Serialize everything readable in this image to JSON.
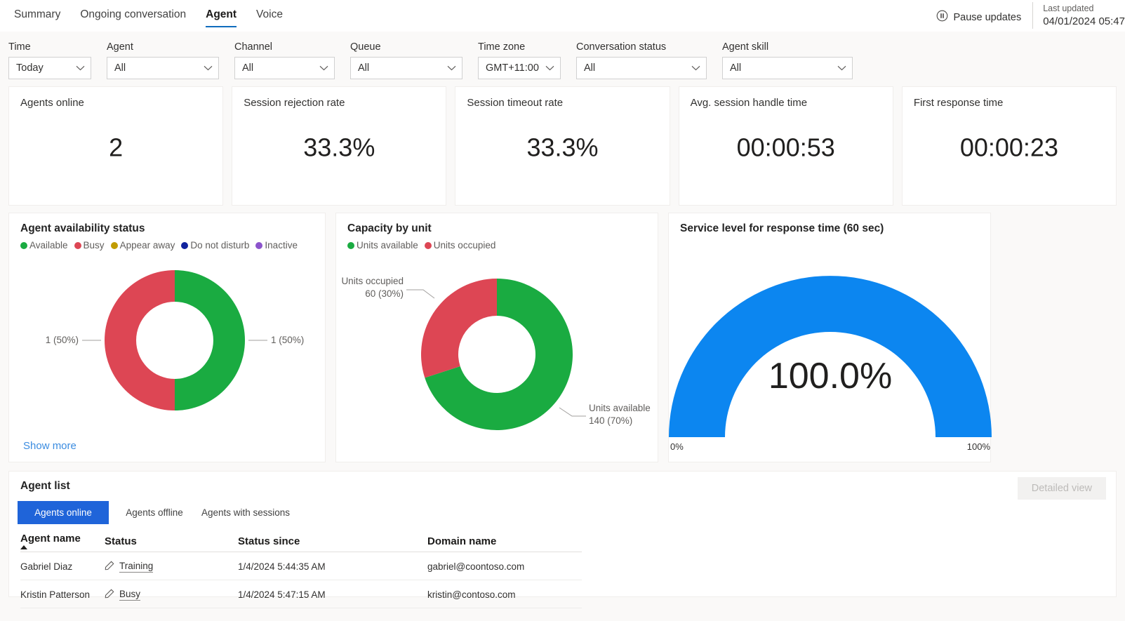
{
  "header": {
    "tabs": [
      {
        "label": "Summary",
        "active": false
      },
      {
        "label": "Ongoing conversation",
        "active": false
      },
      {
        "label": "Agent",
        "active": true
      },
      {
        "label": "Voice",
        "active": false
      }
    ],
    "pause_label": "Pause updates",
    "pause_icon": "pause-circle-icon",
    "last_updated_label": "Last updated",
    "last_updated_value": "04/01/2024 05:47"
  },
  "filters": [
    {
      "label": "Time",
      "value": "Today"
    },
    {
      "label": "Agent",
      "value": "All"
    },
    {
      "label": "Channel",
      "value": "All"
    },
    {
      "label": "Queue",
      "value": "All"
    },
    {
      "label": "Time zone",
      "value": "GMT+11:00"
    },
    {
      "label": "Conversation status",
      "value": "All"
    },
    {
      "label": "Agent skill",
      "value": "All"
    }
  ],
  "kpis": [
    {
      "title": "Agents online",
      "value": "2"
    },
    {
      "title": "Session rejection rate",
      "value": "33.3%"
    },
    {
      "title": "Session timeout rate",
      "value": "33.3%"
    },
    {
      "title": "Avg. session handle time",
      "value": "00:00:53"
    },
    {
      "title": "First response time",
      "value": "00:00:23"
    }
  ],
  "availability": {
    "title": "Agent availability status",
    "show_more": "Show more",
    "legend": [
      {
        "label": "Available",
        "color": "#1aab41"
      },
      {
        "label": "Busy",
        "color": "#dd4654"
      },
      {
        "label": "Appear away",
        "color": "#c19c00"
      },
      {
        "label": "Do not disturb",
        "color": "#10239e"
      },
      {
        "label": "Inactive",
        "color": "#8c54cc"
      }
    ],
    "labels": {
      "left": "1 (50%)",
      "right": "1 (50%)"
    }
  },
  "capacity": {
    "title": "Capacity by unit",
    "legend": [
      {
        "label": "Units available",
        "color": "#1aab41"
      },
      {
        "label": "Units occupied",
        "color": "#dd4654"
      }
    ],
    "labels": {
      "occupied_l1": "Units occupied",
      "occupied_l2": "60 (30%)",
      "available_l1": "Units available",
      "available_l2": "140 (70%)"
    }
  },
  "service_level": {
    "title": "Service level for response time (60 sec)",
    "value": "100.0%",
    "min_label": "0%",
    "max_label": "100%"
  },
  "agent_list": {
    "title": "Agent list",
    "detailed_view": "Detailed view",
    "pills": [
      {
        "label": "Agents online",
        "active": true
      },
      {
        "label": "Agents offline",
        "active": false
      },
      {
        "label": "Agents with sessions",
        "active": false
      }
    ],
    "columns": [
      "Agent name",
      "Status",
      "Status since",
      "Domain name"
    ],
    "rows": [
      {
        "name": "Gabriel Diaz",
        "status": "Training",
        "since": "1/4/2024 5:44:35 AM",
        "domain": "gabriel@coontoso.com"
      },
      {
        "name": "Kristin Patterson",
        "status": "Busy",
        "since": "1/4/2024 5:47:15 AM",
        "domain": "kristin@contoso.com"
      }
    ]
  },
  "chart_data": [
    {
      "type": "pie",
      "title": "Agent availability status",
      "variant": "donut",
      "categories": [
        "Available",
        "Busy",
        "Appear away",
        "Do not disturb",
        "Inactive"
      ],
      "values": [
        1,
        1,
        0,
        0,
        0
      ],
      "percents": [
        50,
        50,
        0,
        0,
        0
      ],
      "colors": [
        "#1aab41",
        "#dd4654",
        "#c19c00",
        "#10239e",
        "#8c54cc"
      ],
      "data_labels": [
        "1 (50%)",
        "1 (50%)"
      ],
      "legend_position": "top"
    },
    {
      "type": "pie",
      "title": "Capacity by unit",
      "variant": "donut",
      "categories": [
        "Units available",
        "Units occupied"
      ],
      "values": [
        140,
        60
      ],
      "percents": [
        70,
        30
      ],
      "colors": [
        "#1aab41",
        "#dd4654"
      ],
      "data_labels": [
        "140 (70%)",
        "60 (30%)"
      ],
      "legend_position": "top"
    },
    {
      "type": "gauge",
      "title": "Service level for response time (60 sec)",
      "value": 100.0,
      "display_value": "100.0%",
      "ylim": [
        0,
        100
      ],
      "tick_labels": [
        "0%",
        "100%"
      ],
      "color": "#0c86f0"
    }
  ]
}
